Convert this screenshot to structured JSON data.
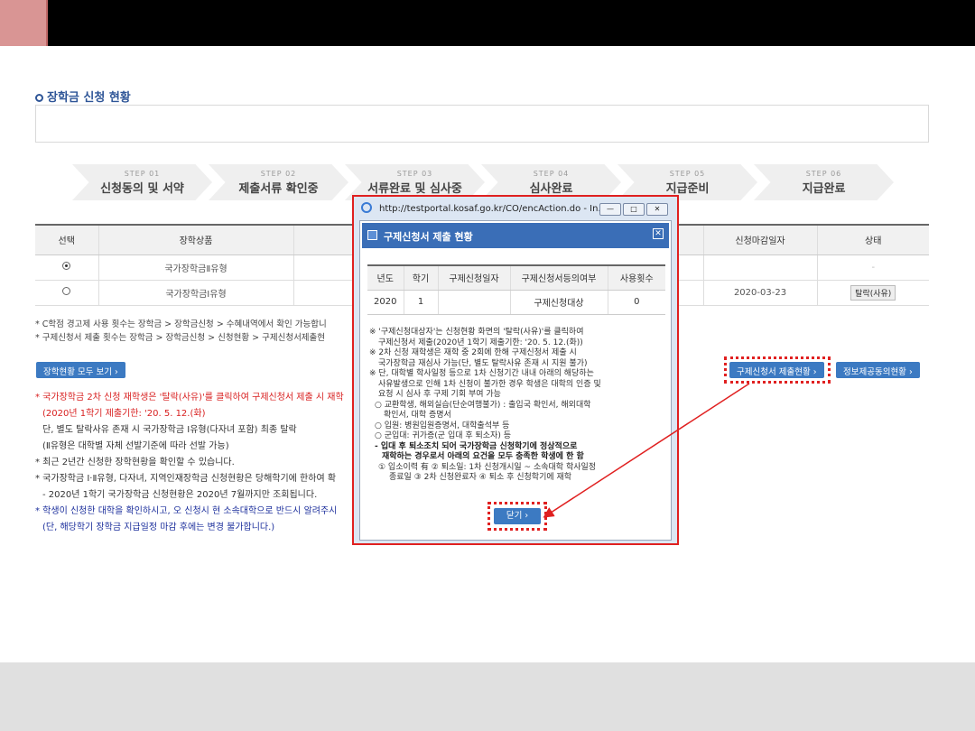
{
  "section": {
    "title": "장학금 신청 현황"
  },
  "steps": [
    {
      "num": "STEP 01",
      "name": "신청동의 및 서약"
    },
    {
      "num": "STEP 02",
      "name": "제출서류 확인중"
    },
    {
      "num": "STEP 03",
      "name": "서류완료 및 심사중"
    },
    {
      "num": "STEP 04",
      "name": "심사완료"
    },
    {
      "num": "STEP 05",
      "name": "지급준비"
    },
    {
      "num": "STEP 06",
      "name": "지급완료"
    }
  ],
  "table": {
    "headers": {
      "select": "선택",
      "product": "장학상품",
      "deadline": "신청마감일자",
      "status": "상태"
    },
    "rows": [
      {
        "product": "국가장학금Ⅱ유형",
        "deadline": "",
        "status": "-",
        "selected": true
      },
      {
        "product": "국가장학금Ⅰ유형",
        "deadline": "2020-03-23",
        "status": "탈락(사유)",
        "selected": false
      }
    ]
  },
  "notes": {
    "line1": "* C학점 경고제 사용 횟수는 장학금 > 장학금신청 > 수혜내역에서 확인 가능합니",
    "line2": "* 구제신청서 제출 횟수는 장학금 > 장학금신청 > 신청현황 > 구제신청서제출현"
  },
  "buttons": {
    "view_all": "장학현황 모두 보기",
    "relief_status": "구제신청서 제출현황",
    "info_consent": "정보제공동의현황"
  },
  "bottom_notes": {
    "l1": "* 국가장학금 2차 신청 재학생은 '탈락(사유)'를 클릭하여 구제신청서 제출 시 재학",
    "l2": "(2020년 1학기 제출기한: '20. 5. 12.(화)",
    "l3": "단, 별도 탈락사유 존재 시 국가장학금 Ⅰ유형(다자녀 포함) 최종 탈락",
    "l4": "(Ⅱ유형은 대학별 자체 선발기준에 따라 선발 가능)",
    "l5": "* 최근 2년간 신청한 장학현황을 확인할 수 있습니다.",
    "l6": "* 국가장학금 Ⅰ·Ⅱ유형, 다자녀, 지역인재장학금 신청현황은 당해학기에 한하여 확",
    "l7": "- 2020년 1학기 국가장학금 신청현황은 2020년 7월까지만 조회됩니다.",
    "l8": "* 학생이 신청한 대학을 확인하시고, 오 신청시 현 소속대학으로 반드시 알려주시",
    "l9": "(단, 해당학기 장학금 지급일정 마감 후에는 변경 불가합니다.)"
  },
  "popup": {
    "url": "http://testportal.kosaf.go.kr/CO/encAction.do - In...",
    "window_controls": {
      "minimize": "—",
      "maximize": "□",
      "close": "✕"
    },
    "header": "구제신청서 제출 현황",
    "table_headers": [
      "년도",
      "학기",
      "구제신청일자",
      "구제신청서등의여부",
      "사용횟수"
    ],
    "table_row": [
      "2020",
      "1",
      "",
      "구제신청대상",
      "0"
    ],
    "notes": [
      "※ '구제신청대상자'는 신청현황 화면의 '탈락(사유)'를 클릭하여",
      "구제신청서 제출(2020년 1학기 제출기한: '20. 5. 12.(화))",
      "※ 2차 신청 재학생은 재학 중 2회에 한해 구제신청서 제출 시",
      "국가장학금 재심사 가능(단, 별도 탈락사유 존재 시 지원 불가)",
      "※ 단, 대학별 학사일정 등으로 1차 신청기간 내내 아래의 해당하는",
      "사유발생으로 인해 1차 신청이 불가한 경우 학생은 대학의 인증 및",
      "요청 시 심사 후 구제 기회 부여 가능",
      "○ 교환학생, 해외실습(단순여행불가) : 출입국 확인서, 해외대학",
      "확인서, 대학 증명서",
      "○ 입원: 병원입원증명서, 대학출석부 등",
      "○ 군입대: 귀가증(군 입대 후 퇴소자) 등",
      "- 입대 후 퇴소조치 되어 국가장학금 신청학기에 정상적으로",
      "재학하는 경우로서 아래의 요건을 모두 충족한 학생에 한 함",
      "① 입소이력 有 ② 퇴소일: 1차 신청개시일 ~ 소속대학 학사일정",
      "종료일 ③ 2차 신청완료자 ④ 퇴소 후 신청학기에 재학"
    ],
    "close_label": "닫기"
  },
  "colors": {
    "accent_red": "#e02020",
    "brand_blue": "#3c7ac2",
    "header_blue": "#3a6eb7"
  }
}
